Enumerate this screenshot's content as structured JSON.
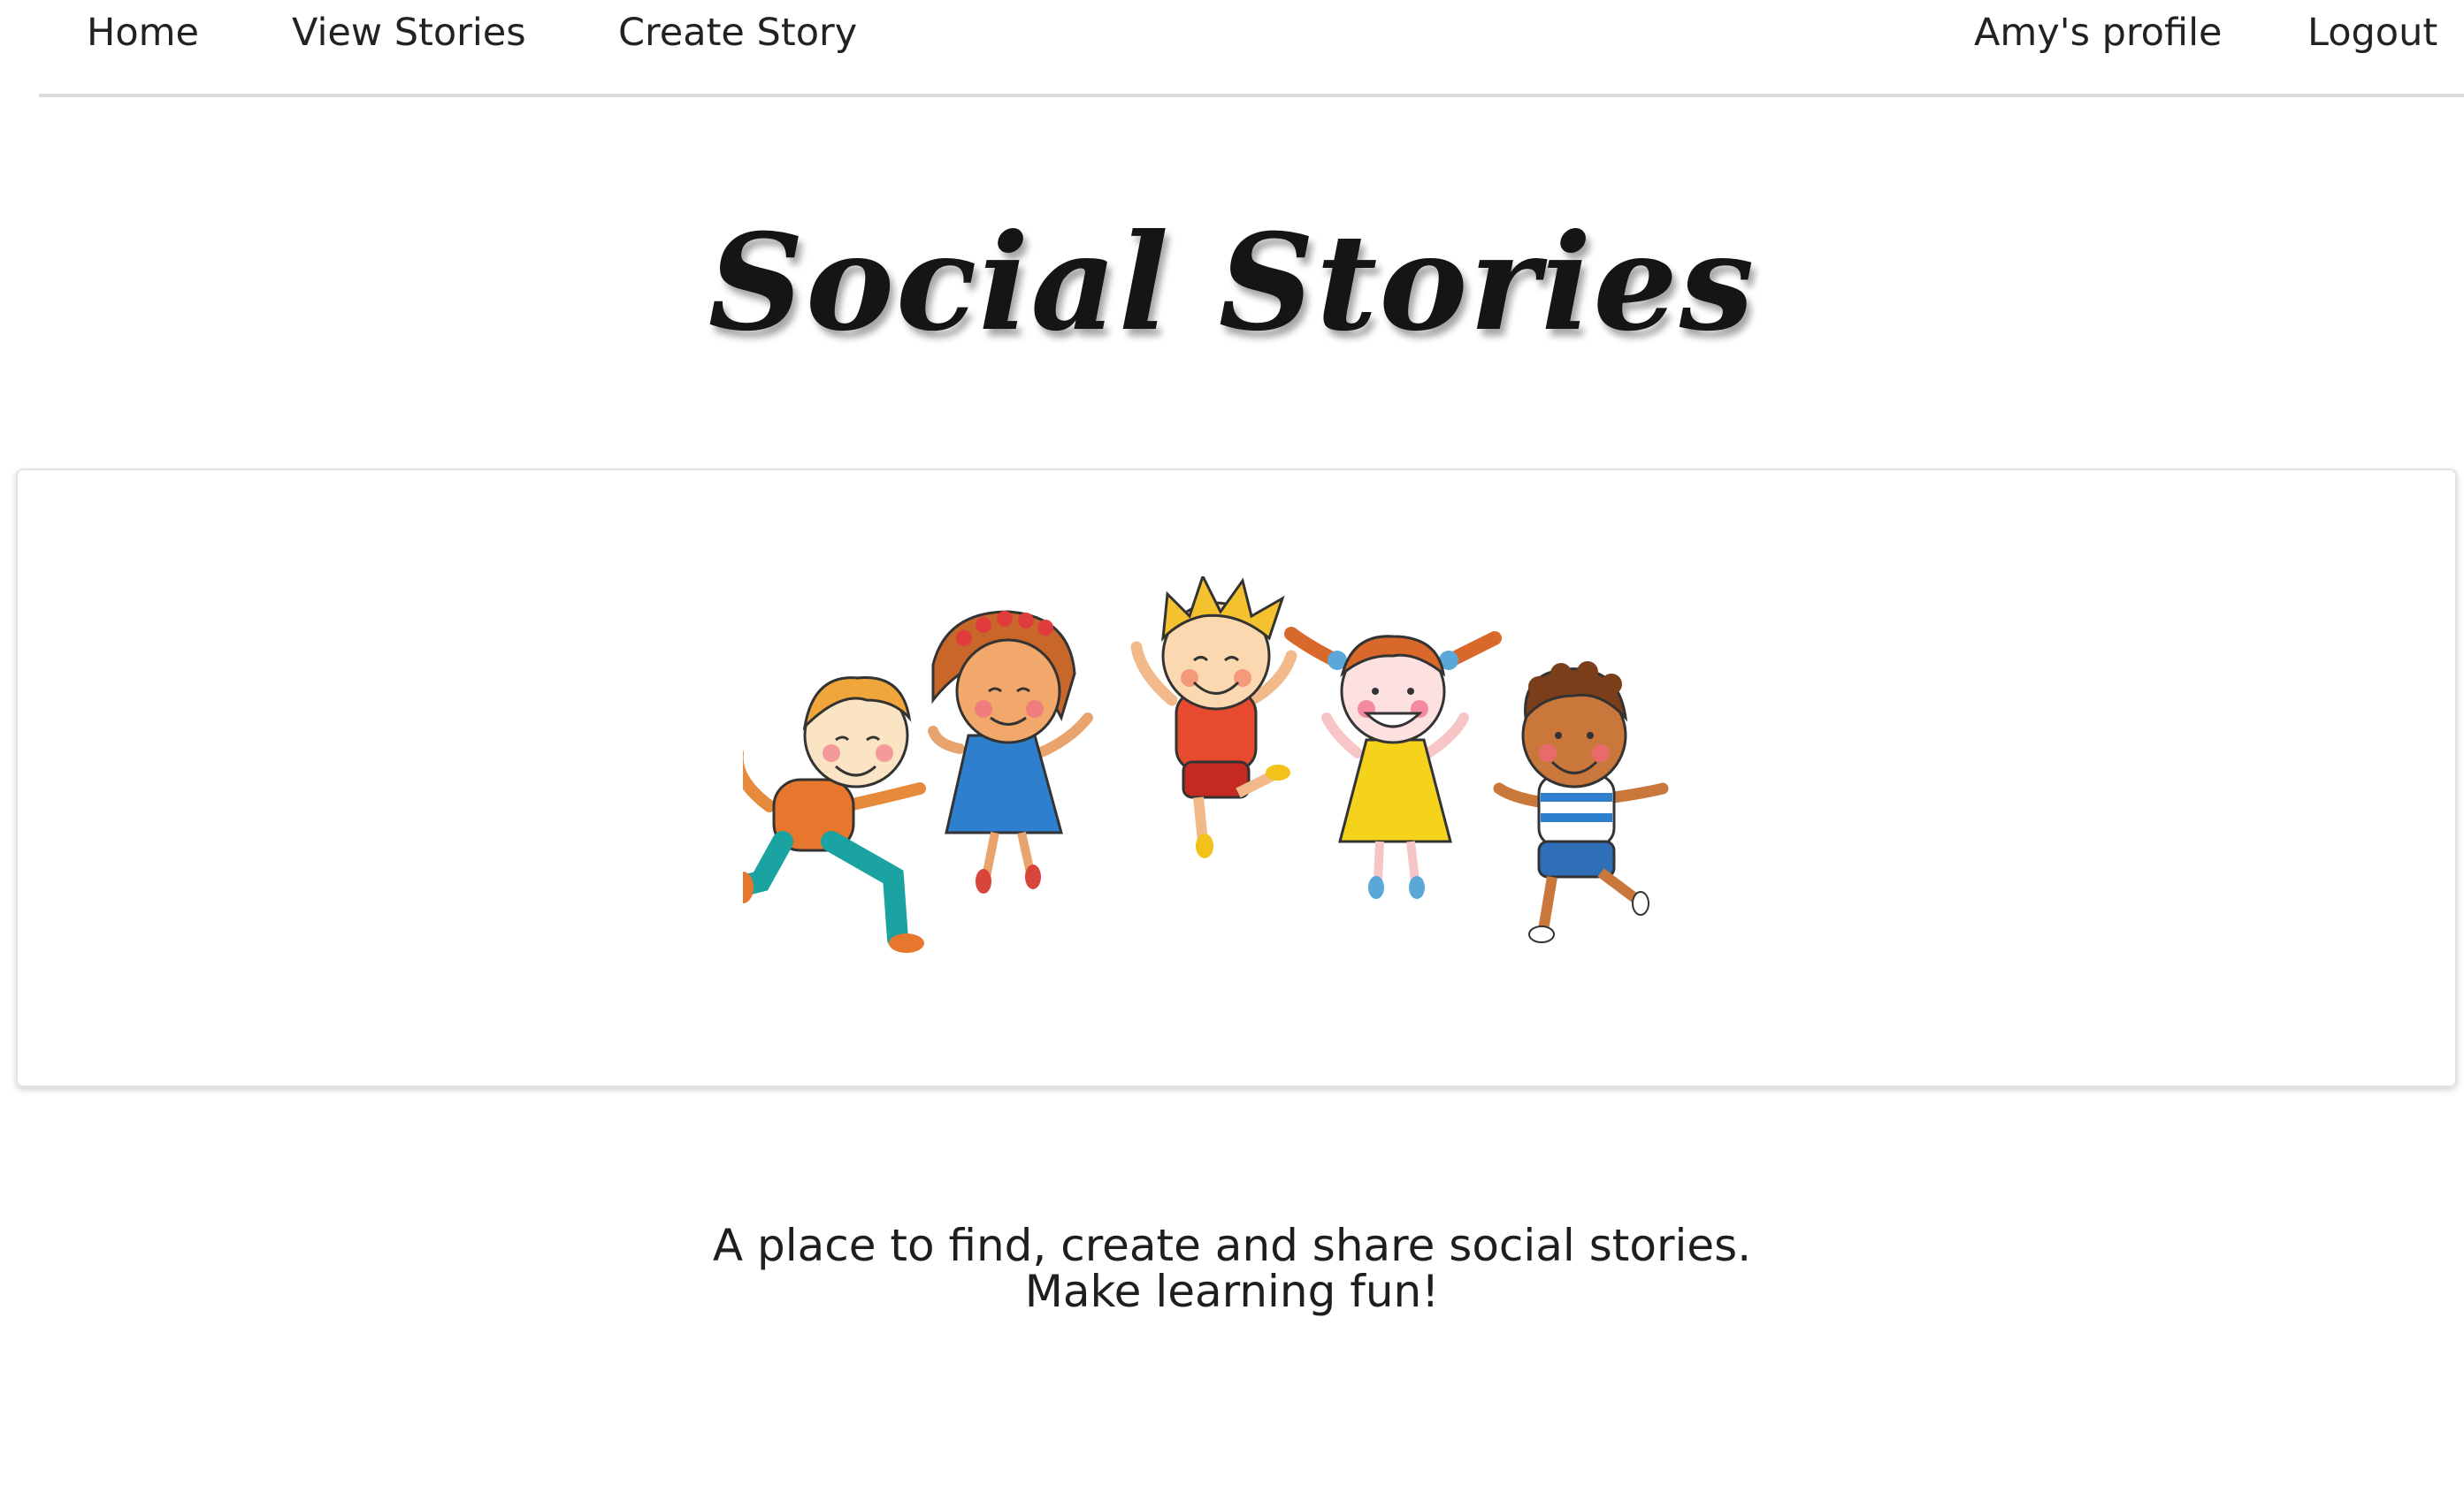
{
  "nav": {
    "home": "Home",
    "view_stories": "View Stories",
    "create_story": "Create Story",
    "profile": "Amy's profile",
    "logout": "Logout"
  },
  "hero": {
    "title": "Social Stories",
    "image": "children-jumping-illustration"
  },
  "tagline": {
    "line1": "A place to find, create and share social stories.",
    "line2": "Make learning fun!"
  }
}
